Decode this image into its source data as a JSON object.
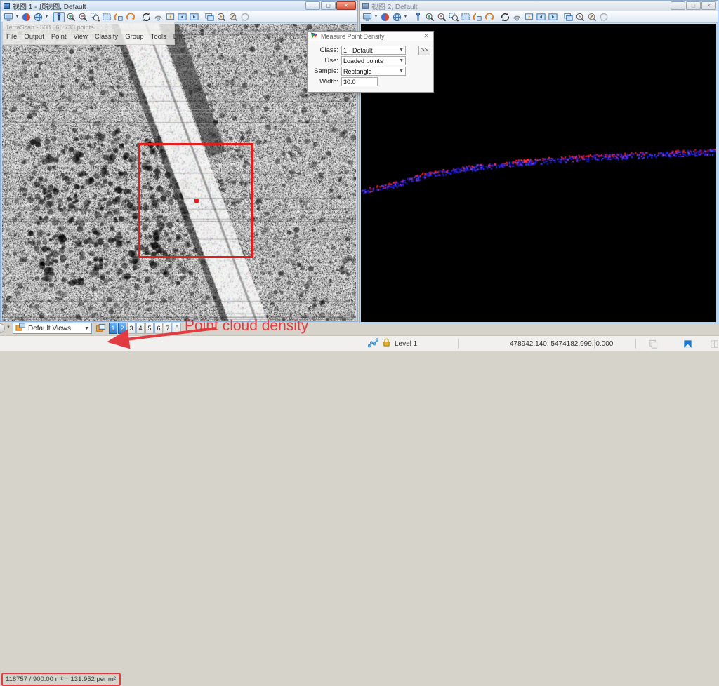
{
  "left_window": {
    "title": "视图 1 - 顶视图, Default",
    "window_buttons": [
      "minimize",
      "restore",
      "close"
    ],
    "toolbar_icons": [
      "view-attributes",
      "caret",
      "adjust-colors",
      "display-style",
      "caret",
      "sep",
      "measure-pin",
      "zoom-in",
      "zoom-out",
      "zoom-window",
      "select-area",
      "rotate-cube",
      "rotate-arc",
      "sep",
      "spin-view",
      "pan-arc",
      "view-flash",
      "view-prev",
      "view-next",
      "sep",
      "copy-view",
      "clip-volume",
      "clip-mask",
      "history"
    ],
    "terrascan": {
      "title": "TerraScan - 508 068 733 points",
      "menu": [
        "File",
        "Output",
        "Point",
        "View",
        "Classify",
        "Group",
        "Tools",
        "Line"
      ]
    }
  },
  "right_window": {
    "title": "视图 2, Default",
    "window_buttons": [
      "minimize",
      "restore",
      "close"
    ],
    "toolbar_icons": [
      "view-attributes",
      "caret",
      "adjust-colors",
      "display-style",
      "caret",
      "sep",
      "measure-pin",
      "zoom-in",
      "zoom-out",
      "zoom-window",
      "select-area",
      "rotate-cube",
      "rotate-arc",
      "sep",
      "spin-view",
      "pan-arc",
      "view-flash",
      "view-prev",
      "view-next",
      "sep",
      "copy-view",
      "clip-volume",
      "clip-mask",
      "history"
    ]
  },
  "dialog": {
    "title": "Measure Point Density",
    "close_glyph": "✕",
    "expand_button": ">>",
    "fields": [
      {
        "label": "Class:",
        "value": "1 - Default",
        "type": "combo"
      },
      {
        "label": "Use:",
        "value": "Loaded points",
        "type": "combo"
      },
      {
        "label": "Sample:",
        "value": "Rectangle",
        "type": "combo"
      },
      {
        "label": "Width:",
        "value": "30.0",
        "type": "input"
      }
    ]
  },
  "view_bar": {
    "combo_value": "Default Views",
    "views": [
      "1",
      "2",
      "3",
      "4",
      "5",
      "6",
      "7",
      "8"
    ],
    "active_views": [
      "1",
      "2"
    ]
  },
  "status_bar": {
    "density_text": "118757 / 900.00 m² = 131.952 per m²",
    "level": "Level 1",
    "coordinates": "478942.140, 5474182.999, 0.000"
  },
  "annotation": {
    "label": "Point cloud density",
    "color": "#e23b41"
  },
  "colors": {
    "annotation_red": "#e23b41",
    "marker_red": "#e31c1c",
    "active_view_blue": "#2f7fd0",
    "point_blue": "#2222ee",
    "point_red": "#ff2020"
  }
}
